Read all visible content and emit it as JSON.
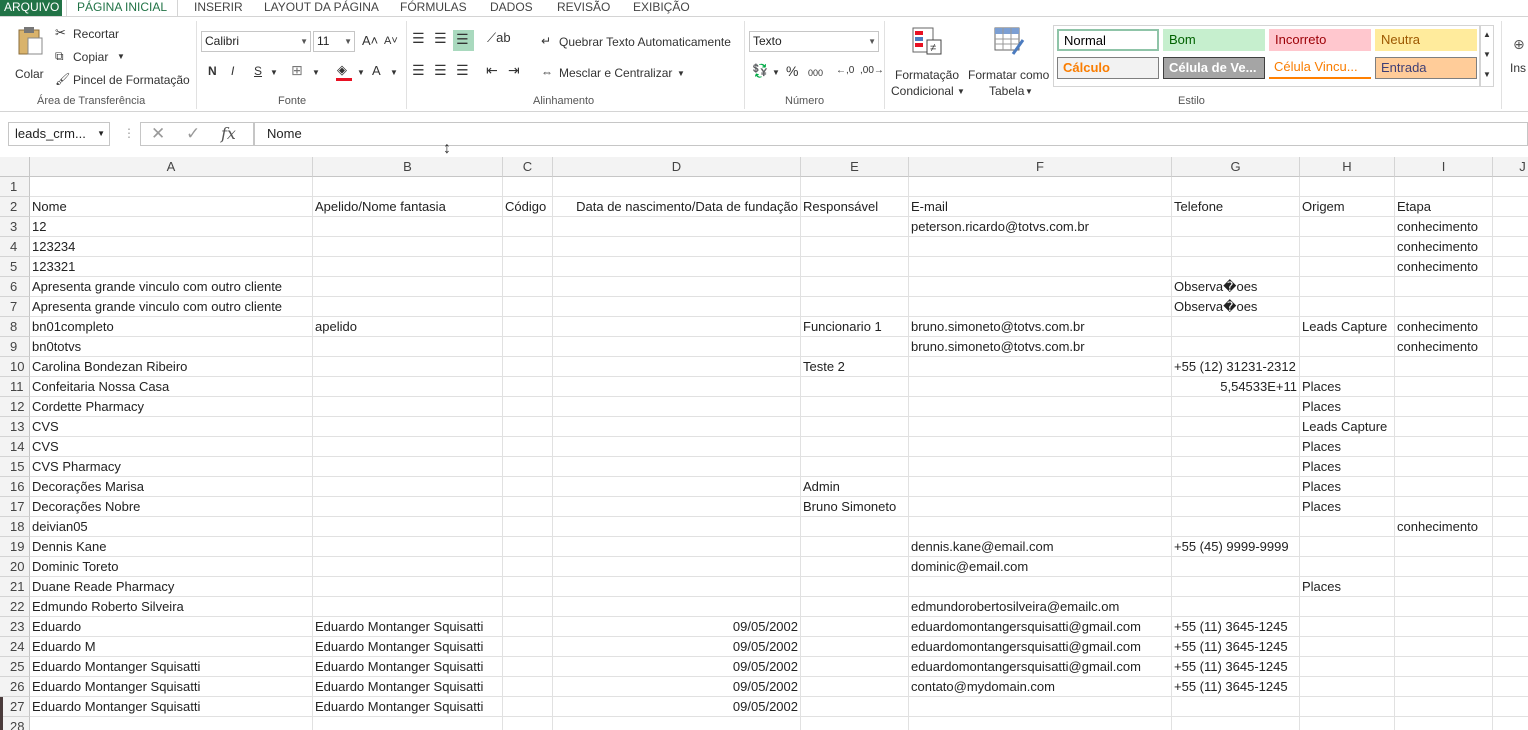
{
  "tabs": [
    "ARQUIVO",
    "PÁGINA INICIAL",
    "INSERIR",
    "LAYOUT DA PÁGINA",
    "FÓRMULAS",
    "DADOS",
    "REVISÃO",
    "EXIBIÇÃO"
  ],
  "clipboard": {
    "paste": "Colar",
    "cut": "Recortar",
    "copy": "Copiar",
    "format_painter": "Pincel de Formatação",
    "label": "Área de Transferência"
  },
  "font": {
    "name": "Calibri",
    "size": "11",
    "label": "Fonte",
    "bold": "N",
    "italic": "I",
    "underline": "S"
  },
  "alignment": {
    "wrap": "Quebrar Texto Automaticamente",
    "merge": "Mesclar e Centralizar",
    "label": "Alinhamento"
  },
  "number": {
    "format": "Texto",
    "label": "Número",
    "percent": "%",
    "thousands": "000"
  },
  "styles_group": {
    "cond_format": [
      "Formatação",
      "Condicional"
    ],
    "format_table": [
      "Formatar como",
      "Tabela"
    ],
    "label": "Estilo",
    "cells": [
      {
        "label": "Normal",
        "bg": "#ffffff",
        "fg": "#000000",
        "border": "#8fc4a8"
      },
      {
        "label": "Bom",
        "bg": "#c6efce",
        "fg": "#006100",
        "border": "#c6efce"
      },
      {
        "label": "Incorreto",
        "bg": "#ffc7ce",
        "fg": "#9c0006",
        "border": "#ffc7ce"
      },
      {
        "label": "Neutra",
        "bg": "#ffeb9c",
        "fg": "#9c5700",
        "border": "#ffeb9c"
      },
      {
        "label": "Cálculo",
        "bg": "#f2f2f2",
        "fg": "#fa7d00",
        "border": "#7f7f7f"
      },
      {
        "label": "Célula de Ve...",
        "bg": "#a5a5a5",
        "fg": "#ffffff",
        "border": "#3f3f3f"
      },
      {
        "label": "Célula Vincu...",
        "bg": "#ffffff",
        "fg": "#fa7d00",
        "border": "#ff8001"
      },
      {
        "label": "Entrada",
        "bg": "#ffcc99",
        "fg": "#3f3f76",
        "border": "#7f7f7f"
      }
    ]
  },
  "insert_label": "Ins",
  "formula_bar": {
    "name_box": "leads_crm...",
    "fx": "fx",
    "content": "Nome"
  },
  "columns": [
    "A",
    "B",
    "C",
    "D",
    "E",
    "F",
    "G",
    "H",
    "I",
    "J"
  ],
  "rows": [
    {
      "n": "1",
      "c": [
        "",
        "",
        "",
        "",
        "",
        "",
        "",
        "",
        ""
      ]
    },
    {
      "n": "2",
      "c": [
        "Nome",
        "Apelido/Nome fantasia",
        "Código",
        "Data de nascimento/Data de fundação",
        "Responsável",
        "E-mail",
        "Telefone",
        "Origem",
        "Etapa"
      ]
    },
    {
      "n": "3",
      "c": [
        "12",
        "",
        "",
        "",
        "",
        "peterson.ricardo@totvs.com.br",
        "",
        "",
        "conhecimento"
      ]
    },
    {
      "n": "4",
      "c": [
        "123234",
        "",
        "",
        "",
        "",
        "",
        "",
        "",
        "conhecimento"
      ]
    },
    {
      "n": "5",
      "c": [
        "123321",
        "",
        "",
        "",
        "",
        "",
        "",
        "",
        "conhecimento"
      ]
    },
    {
      "n": "6",
      "c": [
        "Apresenta grande vinculo com outro cliente",
        "",
        "",
        "",
        "",
        "",
        "Observa�oes",
        "",
        ""
      ]
    },
    {
      "n": "7",
      "c": [
        "Apresenta grande vinculo com outro cliente",
        "",
        "",
        "",
        "",
        "",
        "Observa�oes",
        "",
        ""
      ]
    },
    {
      "n": "8",
      "c": [
        "bn01completo",
        "apelido",
        "",
        "",
        "Funcionario 1",
        "bruno.simoneto@totvs.com.br",
        "",
        "Leads Capture",
        "conhecimento"
      ]
    },
    {
      "n": "9",
      "c": [
        "bn0totvs",
        "",
        "",
        "",
        "",
        "bruno.simoneto@totvs.com.br",
        "",
        "",
        "conhecimento"
      ]
    },
    {
      "n": "10",
      "c": [
        "Carolina Bondezan Ribeiro",
        "",
        "",
        "",
        "Teste 2",
        "",
        "+55 (12) 31231-2312",
        "",
        ""
      ]
    },
    {
      "n": "11",
      "c": [
        "Confeitaria Nossa Casa",
        "",
        "",
        "",
        "",
        "",
        "5,54533E+11",
        "Places",
        ""
      ]
    },
    {
      "n": "12",
      "c": [
        "Cordette Pharmacy",
        "",
        "",
        "",
        "",
        "",
        "",
        "Places",
        ""
      ]
    },
    {
      "n": "13",
      "c": [
        "CVS",
        "",
        "",
        "",
        "",
        "",
        "",
        "Leads Capture",
        ""
      ]
    },
    {
      "n": "14",
      "c": [
        "CVS",
        "",
        "",
        "",
        "",
        "",
        "",
        "Places",
        ""
      ]
    },
    {
      "n": "15",
      "c": [
        "CVS Pharmacy",
        "",
        "",
        "",
        "",
        "",
        "",
        "Places",
        ""
      ]
    },
    {
      "n": "16",
      "c": [
        "Decorações Marisa",
        "",
        "",
        "",
        "Admin",
        "",
        "",
        "Places",
        ""
      ]
    },
    {
      "n": "17",
      "c": [
        "Decorações Nobre",
        "",
        "",
        "",
        "Bruno Simoneto",
        "",
        "",
        "Places",
        ""
      ]
    },
    {
      "n": "18",
      "c": [
        "deivian05",
        "",
        "",
        "",
        "",
        "",
        "",
        "",
        "conhecimento"
      ]
    },
    {
      "n": "19",
      "c": [
        "Dennis Kane",
        "",
        "",
        "",
        "",
        "dennis.kane@email.com",
        "+55 (45) 9999-9999",
        "",
        ""
      ]
    },
    {
      "n": "20",
      "c": [
        "Dominic Toreto",
        "",
        "",
        "",
        "",
        "dominic@email.com",
        "",
        "",
        ""
      ]
    },
    {
      "n": "21",
      "c": [
        "Duane Reade Pharmacy",
        "",
        "",
        "",
        "",
        "",
        "",
        "Places",
        ""
      ]
    },
    {
      "n": "22",
      "c": [
        "Edmundo Roberto Silveira",
        "",
        "",
        "",
        "",
        "edmundorobertosilveira@emailc.om",
        "",
        "",
        ""
      ]
    },
    {
      "n": "23",
      "c": [
        "Eduardo",
        "Eduardo Montanger Squisatti",
        "",
        "09/05/2002",
        "",
        "eduardomontangersquisatti@gmail.com",
        "+55 (11) 3645-1245",
        "",
        ""
      ]
    },
    {
      "n": "24",
      "c": [
        "Eduardo M",
        "Eduardo Montanger Squisatti",
        "",
        "09/05/2002",
        "",
        "eduardomontangersquisatti@gmail.com",
        "+55 (11) 3645-1245",
        "",
        ""
      ]
    },
    {
      "n": "25",
      "c": [
        "Eduardo Montanger Squisatti",
        "Eduardo Montanger Squisatti",
        "",
        "09/05/2002",
        "",
        "eduardomontangersquisatti@gmail.com",
        "+55 (11) 3645-1245",
        "",
        ""
      ]
    },
    {
      "n": "26",
      "c": [
        "Eduardo Montanger Squisatti",
        "Eduardo Montanger Squisatti",
        "",
        "09/05/2002",
        "",
        "contato@mydomain.com",
        "+55 (11) 3645-1245",
        "",
        ""
      ]
    },
    {
      "n": "27",
      "c": [
        "Eduardo Montanger Squisatti",
        "Eduardo Montanger Squisatti",
        "",
        "09/05/2002",
        "",
        "",
        "",
        "",
        ""
      ]
    },
    {
      "n": "28",
      "c": [
        "",
        "",
        "",
        "",
        "",
        "",
        "",
        "",
        ""
      ]
    }
  ]
}
